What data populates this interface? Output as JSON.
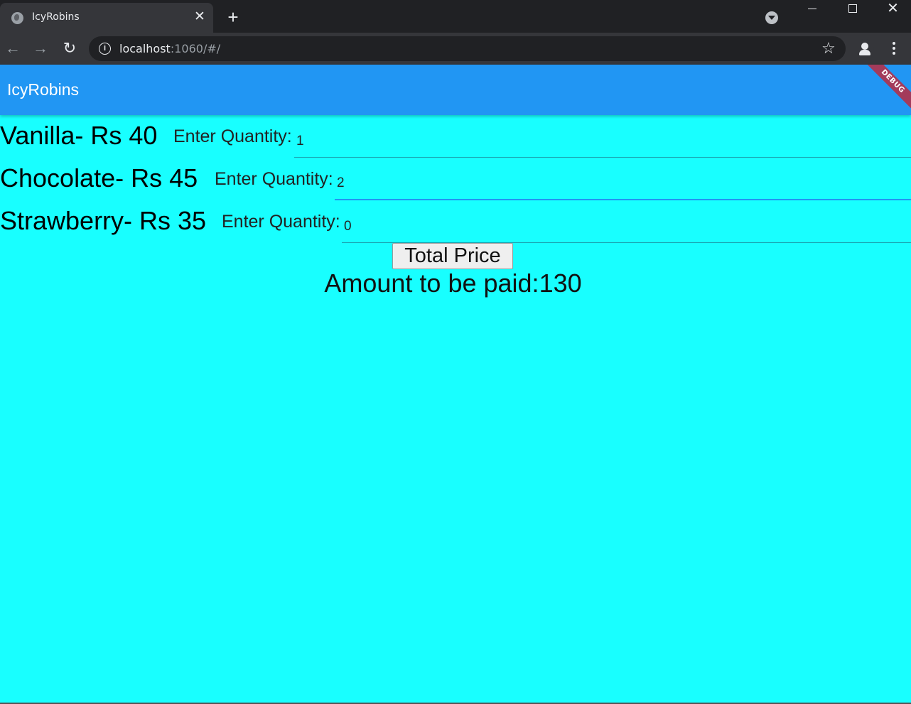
{
  "browser": {
    "tab_title": "IcyRobins",
    "tab_close": "✕",
    "new_tab": "+",
    "url_host": "localhost",
    "url_rest": ":1060/#/",
    "win_close": "✕"
  },
  "app": {
    "title": "IcyRobins",
    "debug_banner": "DEBUG"
  },
  "items": [
    {
      "flavor": "Vanilla- Rs 40",
      "qty_label": "Enter Quantity:",
      "qty_value": "1"
    },
    {
      "flavor": "Chocolate- Rs 45",
      "qty_label": "Enter Quantity:",
      "qty_value": "2"
    },
    {
      "flavor": "Strawberry- Rs 35",
      "qty_label": "Enter Quantity:",
      "qty_value": "0"
    }
  ],
  "total_button": "Total Price",
  "amount_text": "Amount to be paid:130",
  "colors": {
    "background": "#18ffff",
    "appbar": "#2196f3",
    "focus_underline": "#2196f3"
  },
  "icons": [
    "globe-icon",
    "close-icon",
    "plus-icon",
    "tab-search-icon",
    "minimize-icon",
    "maximize-icon",
    "back-arrow-icon",
    "forward-arrow-icon",
    "reload-icon",
    "info-icon",
    "star-icon",
    "profile-icon",
    "kebab-menu-icon"
  ]
}
